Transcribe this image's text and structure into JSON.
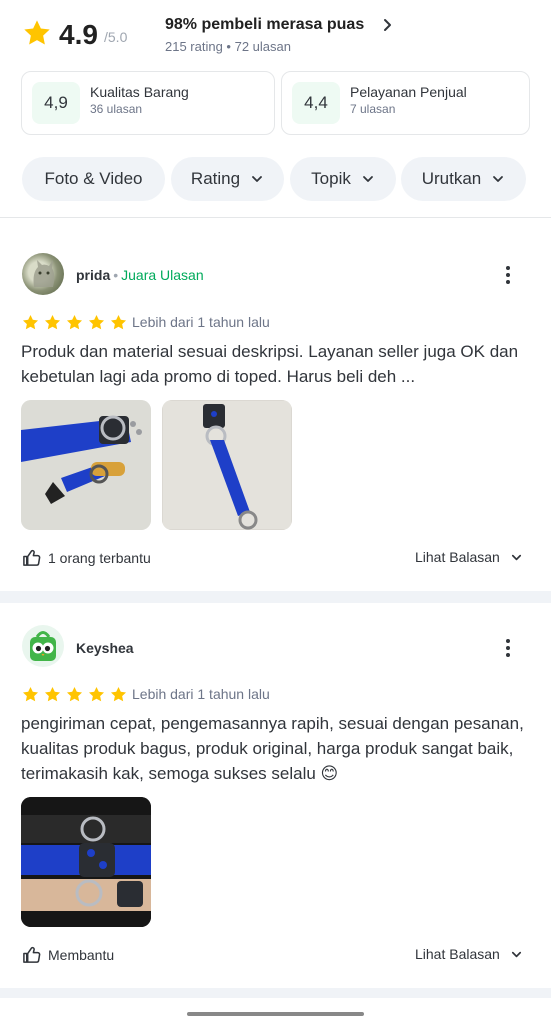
{
  "summary": {
    "rating": "4.9",
    "rating_max": "/5.0",
    "satisfaction": "98% pembeli merasa puas",
    "meta": "215 rating • 72 ulasan",
    "cards": [
      {
        "score": "4,9",
        "name": "Kualitas Barang",
        "count": "36 ulasan"
      },
      {
        "score": "4,4",
        "name": "Pelayanan Penjual",
        "count": "7 ulasan"
      }
    ]
  },
  "filters": [
    {
      "label": "Foto & Video"
    },
    {
      "label": "Rating"
    },
    {
      "label": "Topik"
    },
    {
      "label": "Urutkan"
    }
  ],
  "reviews": [
    {
      "name": "prida",
      "badge_sep": "•",
      "badge": "Juara Ulasan",
      "stars": 5,
      "time": "Lebih dari 1 tahun lalu",
      "text": "Produk dan material sesuai deskripsi. Layanan seller juga OK dan kebetulan lagi ada promo di toped. Harus beli deh ...",
      "helpful": "1 orang terbantu",
      "reply": "Lihat Balasan"
    },
    {
      "name": "Keyshea",
      "stars": 5,
      "time": "Lebih dari 1 tahun lalu",
      "text": "pengiriman cepat, pengemasannya rapih, sesuai dengan pesanan, kualitas produk bagus, produk original, harga produk sangat baik, terimakasih kak, semoga sukses selalu 😊",
      "helpful": "Membantu",
      "reply": "Lihat Balasan"
    }
  ],
  "colors": {
    "star": "#ffc400",
    "accent_green": "#00aa5b",
    "chip_bg": "#f0f3f7",
    "strap_blue": "#1e3fc8"
  }
}
